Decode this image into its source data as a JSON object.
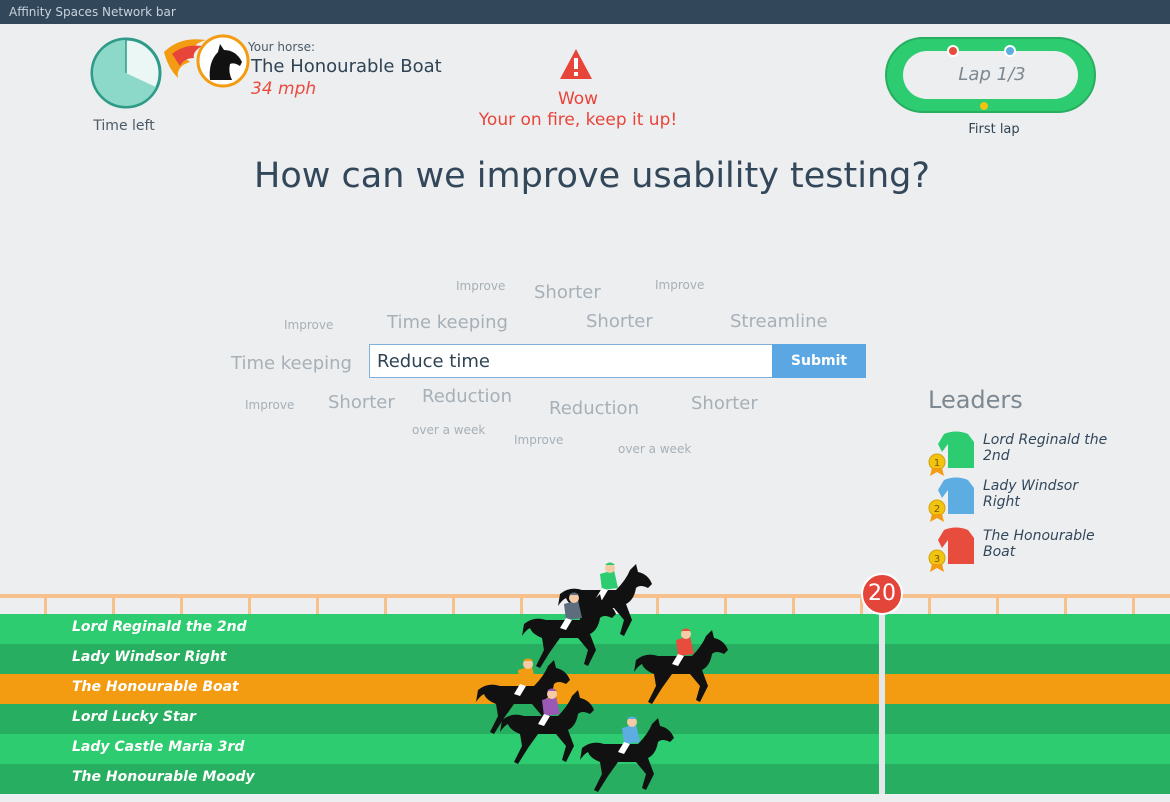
{
  "network_bar": {
    "title": "Affinity Spaces Network bar"
  },
  "timer": {
    "label": "Time left",
    "remaining_fraction": 0.68
  },
  "horse": {
    "label": "Your horse:",
    "name": "The Honourable Boat",
    "speed": "34 mph"
  },
  "alert": {
    "title": "Wow",
    "message": "Your on fire, keep it up!",
    "icon": "warning-triangle-icon"
  },
  "lap": {
    "text": "Lap 1/3",
    "caption": "First lap"
  },
  "question": "How can we improve usability testing?",
  "word_cloud": [
    "Improve",
    "Shorter",
    "Improve",
    "Improve",
    "Time keeping",
    "Shorter",
    "Streamline",
    "Time keeping",
    "Improve",
    "Shorter",
    "Reduction",
    "Reduction",
    "Shorter",
    "over a week",
    "Improve",
    "over a week"
  ],
  "answer": {
    "value": "Reduce time",
    "submit_label": "Submit"
  },
  "leaders": {
    "title": "Leaders",
    "items": [
      {
        "rank": "1",
        "name": "Lord Reginald the 2nd",
        "color": "#2ecc71"
      },
      {
        "rank": "2",
        "name": "Lady Windsor Right",
        "color": "#5dade2"
      },
      {
        "rank": "3",
        "name": "The Honourable Boat",
        "color": "#e74c3c"
      }
    ]
  },
  "race": {
    "marker": "20",
    "lanes": [
      "Lord Reginald the 2nd",
      "Lady Windsor Right",
      "The Honourable Boat",
      "Lord Lucky Star",
      "Lady Castle Maria 3rd",
      "The Honourable Moody"
    ],
    "highlighted_lane": 2,
    "colors": {
      "grass": "#2ecc71",
      "grass_dark": "#27ae60",
      "highlight": "#f39c12",
      "fence": "#f5c08c"
    }
  }
}
